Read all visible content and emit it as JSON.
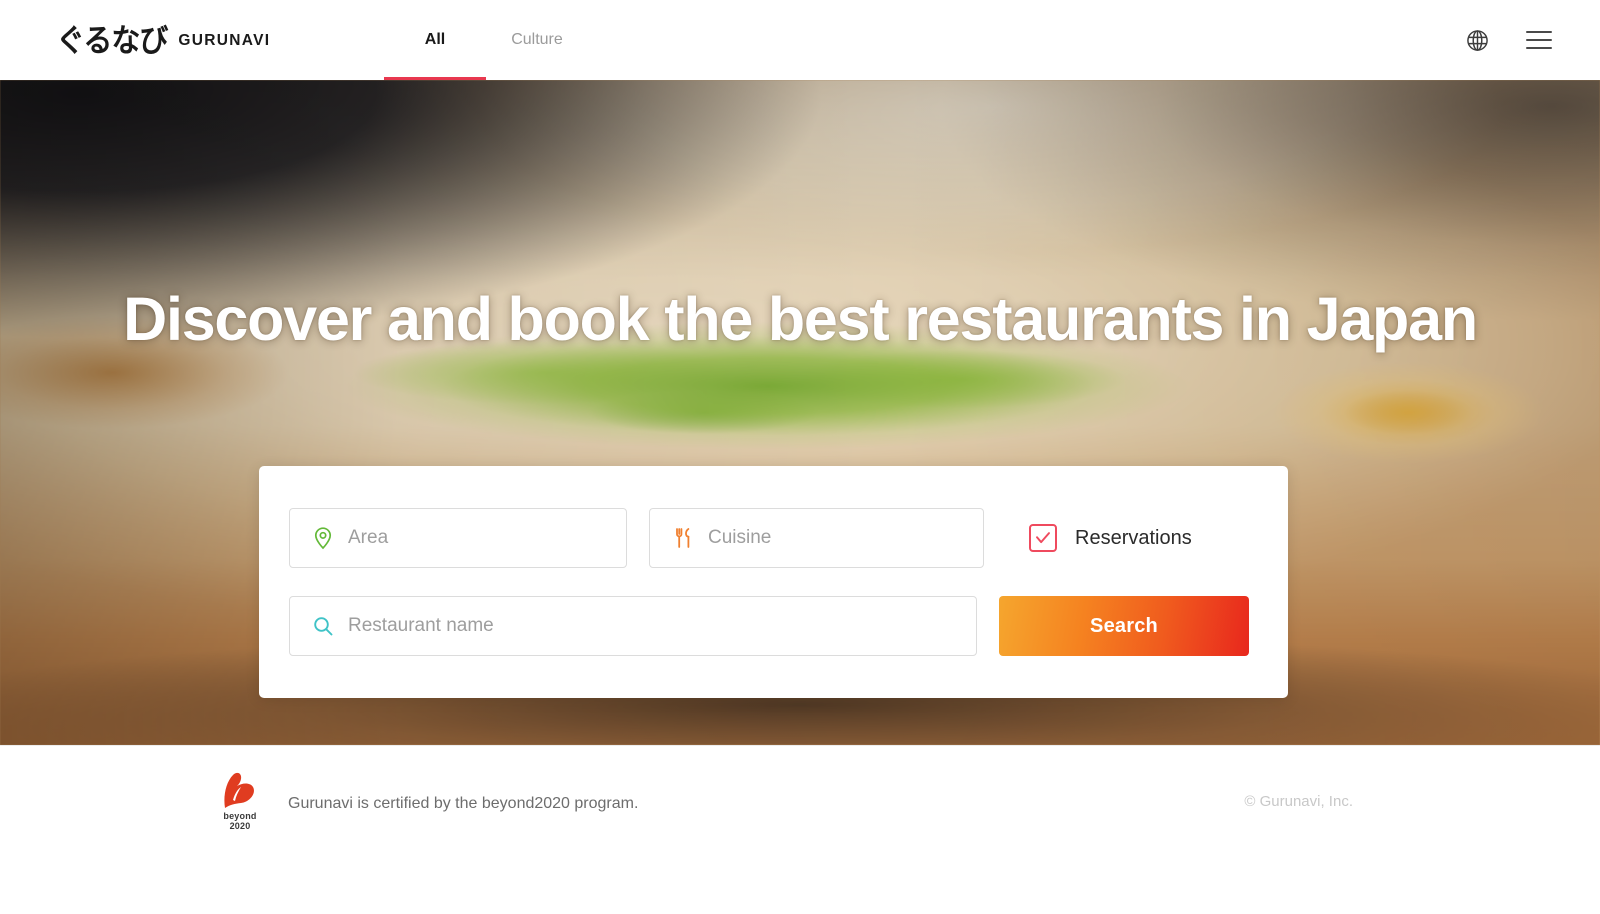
{
  "header": {
    "logo_jp": "ぐるなび",
    "logo_en": "GURUNAVI",
    "tabs": [
      {
        "label": "All",
        "active": true
      },
      {
        "label": "Culture",
        "active": false
      }
    ],
    "language_icon": "globe-icon",
    "menu_icon": "hamburger-menu-icon",
    "active_tab_underline_color": "#e8384f"
  },
  "hero": {
    "title": "Discover and book the best restaurants in Japan",
    "background_description": "close-up photo of a noodle soup bowl with green scallions and a wooden spoon"
  },
  "search": {
    "area": {
      "placeholder": "Area",
      "value": "",
      "icon": "location-pin-icon",
      "icon_color": "#63b938"
    },
    "cuisine": {
      "placeholder": "Cuisine",
      "value": "",
      "icon": "fork-knife-icon",
      "icon_color": "#f08030"
    },
    "restaurant_name": {
      "placeholder": "Restaurant name",
      "value": "",
      "icon": "search-magnifier-icon",
      "icon_color": "#3fc3c7"
    },
    "reservations": {
      "label": "Reservations",
      "checked": true,
      "accent_color": "#ef4a5e"
    },
    "search_button": {
      "label": "Search",
      "gradient_from": "#f5a62e",
      "gradient_to": "#e8271d"
    }
  },
  "footer": {
    "beyond_logo_line1": "beyond",
    "beyond_logo_line2": "2020",
    "certification_text": "Gurunavi is certified by the beyond2020 program.",
    "copyright": "© Gurunavi, Inc."
  }
}
